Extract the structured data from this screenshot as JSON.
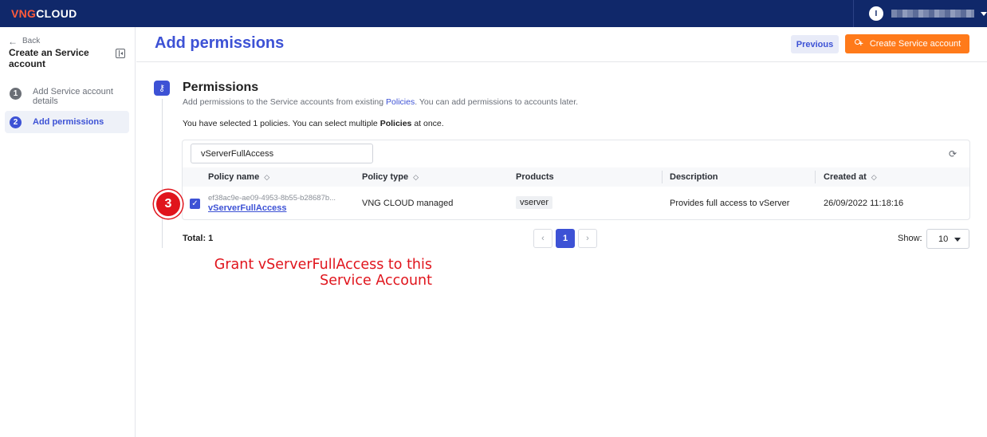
{
  "app": {
    "logo_prefix": "VNG",
    "logo_suffix": "CLOUD",
    "user_initial": "I"
  },
  "sidebar": {
    "back_label": "Back",
    "title": "Create an Service account",
    "steps": [
      {
        "number": "1",
        "label": "Add Service account details"
      },
      {
        "number": "2",
        "label": "Add permissions"
      }
    ]
  },
  "header": {
    "title": "Add permissions",
    "previous_label": "Previous",
    "create_label": "Create Service account"
  },
  "section": {
    "title": "Permissions",
    "desc_before": "Add permissions to the Service accounts from existing ",
    "desc_link": "Policies",
    "desc_after": ". You can add permissions to accounts later.",
    "selected_before": "You have selected 1 policies. You can select multiple ",
    "selected_bold": "Policies",
    "selected_after": " at once."
  },
  "search": {
    "value": "vServerFullAccess"
  },
  "table": {
    "columns": {
      "policy_name": "Policy name",
      "policy_type": "Policy type",
      "products": "Products",
      "description": "Description",
      "created_at": "Created at"
    },
    "rows": [
      {
        "checked": true,
        "id": "ef38ac9e-ae09-4953-8b55-b28687b...",
        "name": "vServerFullAccess",
        "type": "VNG CLOUD managed",
        "product": "vserver",
        "description": "Provides full access to vServer",
        "created_at": "26/09/2022 11:18:16"
      }
    ]
  },
  "footer": {
    "total": "Total: 1",
    "current_page": "1",
    "show_label": "Show:",
    "page_size": "10"
  },
  "annotation": {
    "badge": "3",
    "text_line1": "Grant vServerFullAccess to this",
    "text_line2": "Service Account"
  },
  "colors": {
    "brand_navy": "#10286a",
    "accent_blue": "#3d52d5",
    "action_orange": "#ff7a1a",
    "annotation_red": "#e0141c"
  }
}
